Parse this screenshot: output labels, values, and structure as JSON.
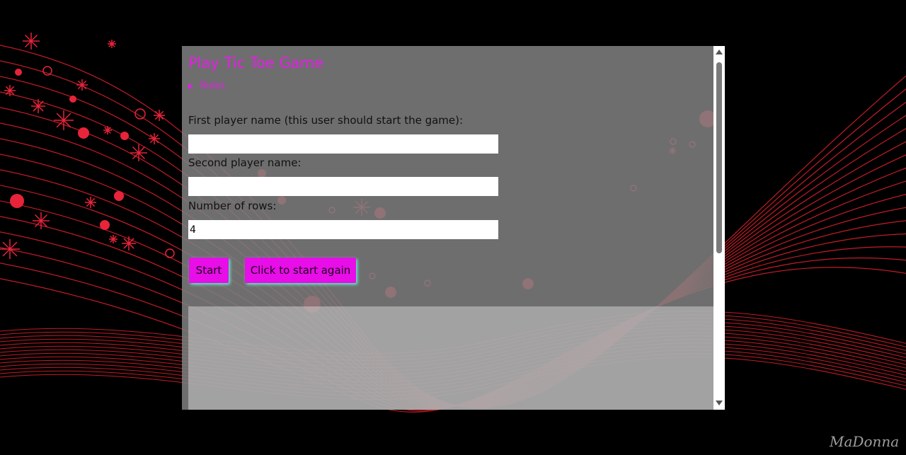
{
  "page": {
    "title": "Play Tic Toe Game",
    "rules_label": "Rules"
  },
  "form": {
    "first_player_label": "First player name (this user should start the game):",
    "first_player_value": "",
    "second_player_label": "Second player name:",
    "second_player_value": "",
    "rows_label": "Number of rows:",
    "rows_value": "4"
  },
  "buttons": {
    "start_label": "Start",
    "restart_label": "Click to start again"
  },
  "watermark": "MaDonna",
  "colors": {
    "accent": "#e81de8",
    "button": "#e80ee8",
    "panel": "#808080",
    "wave": "#e0202c"
  },
  "icons": {
    "rules_marker": "triangle-right-icon",
    "scroll_up": "scroll-up-arrow-icon",
    "scroll_down": "scroll-down-arrow-icon"
  }
}
